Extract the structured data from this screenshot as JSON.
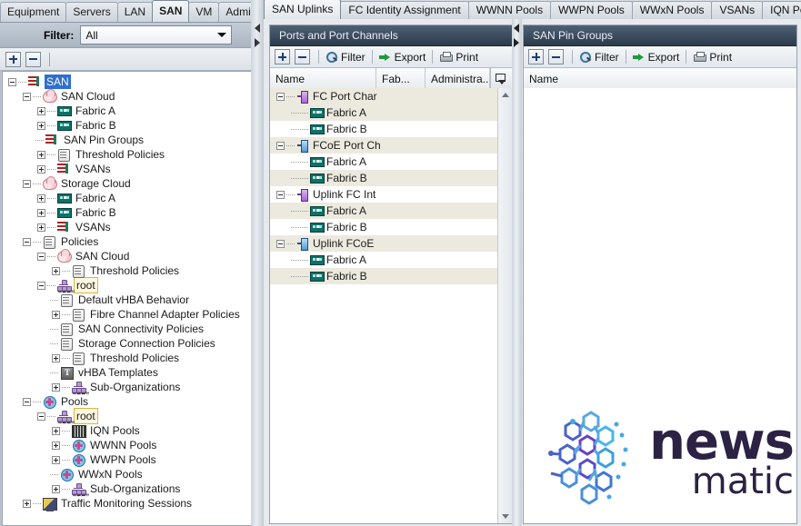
{
  "nav": {
    "tabs": [
      {
        "label": "Equipment",
        "active": false
      },
      {
        "label": "Servers",
        "active": false
      },
      {
        "label": "LAN",
        "active": false
      },
      {
        "label": "SAN",
        "active": true
      },
      {
        "label": "VM",
        "active": false
      },
      {
        "label": "Admin",
        "active": false
      }
    ]
  },
  "filter": {
    "label": "Filter:",
    "value": "All",
    "placeholder": "All",
    "options": [
      "All"
    ]
  },
  "left_toolbar": {
    "expand_all": "+",
    "collapse_all": "-"
  },
  "tree": [
    {
      "label": "SAN",
      "depth": 0,
      "twist": "minus",
      "icon": "list-icon",
      "state": "selected"
    },
    {
      "label": "SAN Cloud",
      "depth": 1,
      "twist": "minus",
      "icon": "cloud-icon",
      "state": "normal"
    },
    {
      "label": "Fabric A",
      "depth": 2,
      "twist": "plus",
      "icon": "switch-icon",
      "state": "normal"
    },
    {
      "label": "Fabric B",
      "depth": 2,
      "twist": "plus",
      "icon": "switch-icon",
      "state": "normal"
    },
    {
      "label": "SAN Pin Groups",
      "depth": 2,
      "twist": "leaf",
      "icon": "list-icon",
      "state": "normal"
    },
    {
      "label": "Threshold Policies",
      "depth": 2,
      "twist": "plus",
      "icon": "scroll-icon",
      "state": "normal"
    },
    {
      "label": "VSANs",
      "depth": 2,
      "twist": "plus",
      "icon": "list-icon",
      "state": "normal"
    },
    {
      "label": "Storage Cloud",
      "depth": 1,
      "twist": "minus",
      "icon": "cloud-icon",
      "state": "normal"
    },
    {
      "label": "Fabric A",
      "depth": 2,
      "twist": "plus",
      "icon": "switch-icon",
      "state": "normal"
    },
    {
      "label": "Fabric B",
      "depth": 2,
      "twist": "plus",
      "icon": "switch-icon",
      "state": "normal"
    },
    {
      "label": "VSANs",
      "depth": 2,
      "twist": "plus",
      "icon": "list-icon",
      "state": "normal"
    },
    {
      "label": "Policies",
      "depth": 1,
      "twist": "minus",
      "icon": "scroll-icon",
      "state": "normal"
    },
    {
      "label": "SAN Cloud",
      "depth": 2,
      "twist": "minus",
      "icon": "cloud-icon",
      "state": "normal"
    },
    {
      "label": "Threshold Policies",
      "depth": 3,
      "twist": "plus",
      "icon": "scroll-icon",
      "state": "normal"
    },
    {
      "label": "root",
      "depth": 2,
      "twist": "minus",
      "icon": "org-icon",
      "state": "highlight"
    },
    {
      "label": "Default vHBA Behavior",
      "depth": 3,
      "twist": "leaf",
      "icon": "scroll-icon",
      "state": "normal"
    },
    {
      "label": "Fibre Channel Adapter Policies",
      "depth": 3,
      "twist": "plus",
      "icon": "scroll-icon",
      "state": "normal"
    },
    {
      "label": "SAN Connectivity Policies",
      "depth": 3,
      "twist": "leaf",
      "icon": "scroll-icon",
      "state": "normal"
    },
    {
      "label": "Storage Connection Policies",
      "depth": 3,
      "twist": "leaf",
      "icon": "scroll-icon",
      "state": "normal"
    },
    {
      "label": "Threshold Policies",
      "depth": 3,
      "twist": "plus",
      "icon": "scroll-icon",
      "state": "normal"
    },
    {
      "label": "vHBA Templates",
      "depth": 3,
      "twist": "leaf",
      "icon": "template-icon",
      "state": "normal"
    },
    {
      "label": "Sub-Organizations",
      "depth": 3,
      "twist": "plus",
      "icon": "org-icon",
      "state": "normal"
    },
    {
      "label": "Pools",
      "depth": 1,
      "twist": "minus",
      "icon": "pool-icon",
      "state": "normal"
    },
    {
      "label": "root",
      "depth": 2,
      "twist": "minus",
      "icon": "org-icon",
      "state": "highlight"
    },
    {
      "label": "IQN Pools",
      "depth": 3,
      "twist": "plus",
      "icon": "iqn-icon",
      "state": "normal"
    },
    {
      "label": "WWNN Pools",
      "depth": 3,
      "twist": "plus",
      "icon": "pool-icon",
      "state": "normal"
    },
    {
      "label": "WWPN Pools",
      "depth": 3,
      "twist": "plus",
      "icon": "pool-icon",
      "state": "normal"
    },
    {
      "label": "WWxN Pools",
      "depth": 3,
      "twist": "leaf",
      "icon": "pool-icon",
      "state": "normal"
    },
    {
      "label": "Sub-Organizations",
      "depth": 3,
      "twist": "plus",
      "icon": "org-icon",
      "state": "normal"
    },
    {
      "label": "Traffic Monitoring Sessions",
      "depth": 1,
      "twist": "plus",
      "icon": "monitor-icon",
      "state": "normal"
    }
  ],
  "work_tabs": [
    {
      "label": "SAN Uplinks",
      "active": true
    },
    {
      "label": "FC Identity Assignment",
      "active": false
    },
    {
      "label": "WWNN Pools",
      "active": false
    },
    {
      "label": "WWPN Pools",
      "active": false
    },
    {
      "label": "WWxN Pools",
      "active": false
    },
    {
      "label": "VSANs",
      "active": false
    },
    {
      "label": "IQN Pools",
      "active": false
    }
  ],
  "toolbar_labels": {
    "add": "+",
    "remove": "-",
    "filter": "Filter",
    "export": "Export",
    "print": "Print"
  },
  "ports_panel": {
    "title": "Ports and Port Channels",
    "columns": [
      "Name",
      "Fab...",
      "Administra..."
    ],
    "rows": [
      {
        "name": "FC Port Char",
        "depth": 0,
        "twist": "minus",
        "icon": "port-purple-icon",
        "alt": true
      },
      {
        "name": "Fabric A",
        "depth": 1,
        "twist": "leaf",
        "icon": "switch-icon",
        "alt": true
      },
      {
        "name": "Fabric B",
        "depth": 1,
        "twist": "leaf",
        "icon": "switch-icon",
        "alt": false
      },
      {
        "name": "FCoE Port Ch",
        "depth": 0,
        "twist": "minus",
        "icon": "port-blue-icon",
        "alt": true
      },
      {
        "name": "Fabric A",
        "depth": 1,
        "twist": "leaf",
        "icon": "switch-icon",
        "alt": false
      },
      {
        "name": "Fabric B",
        "depth": 1,
        "twist": "leaf",
        "icon": "switch-icon",
        "alt": true
      },
      {
        "name": "Uplink FC Int",
        "depth": 0,
        "twist": "minus",
        "icon": "port-purple-icon",
        "alt": false
      },
      {
        "name": "Fabric A",
        "depth": 1,
        "twist": "leaf",
        "icon": "switch-icon",
        "alt": true
      },
      {
        "name": "Fabric B",
        "depth": 1,
        "twist": "leaf",
        "icon": "switch-icon",
        "alt": false
      },
      {
        "name": "Uplink FCoE",
        "depth": 0,
        "twist": "minus",
        "icon": "port-blue-icon",
        "alt": true
      },
      {
        "name": "Fabric A",
        "depth": 1,
        "twist": "leaf",
        "icon": "switch-icon",
        "alt": false
      },
      {
        "name": "Fabric B",
        "depth": 1,
        "twist": "leaf",
        "icon": "switch-icon",
        "alt": true
      }
    ]
  },
  "pin_panel": {
    "title": "SAN Pin Groups",
    "columns": [
      "Name"
    ],
    "rows": []
  },
  "logo": {
    "line1": "news",
    "line2": "matic"
  },
  "colors": {
    "accent": "#2f6fd0",
    "panel_title_bg": "#2c3b4b",
    "highlight_border": "#d9b441",
    "alt_row": "#eceade",
    "logo_text": "#2c2244"
  }
}
